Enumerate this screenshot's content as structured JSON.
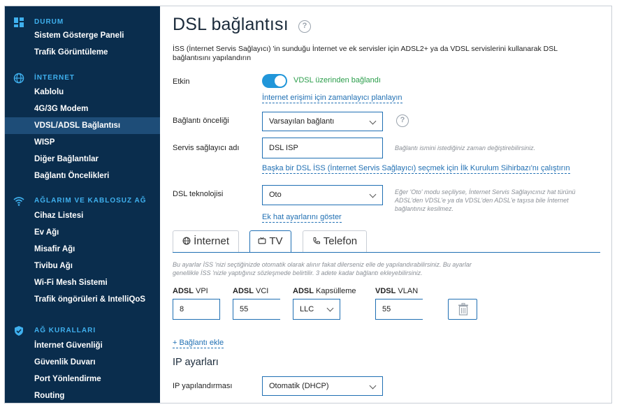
{
  "sidebar": {
    "sections": [
      {
        "title": "DURUM",
        "icon": "dashboard-icon",
        "items": [
          "Sistem Gösterge Paneli",
          "Trafik Görüntüleme"
        ]
      },
      {
        "title": "İNTERNET",
        "icon": "globe-icon",
        "items": [
          "Kablolu",
          "4G/3G Modem",
          "VDSL/ADSL Bağlantısı",
          "WISP",
          "Diğer Bağlantılar",
          "Bağlantı Öncelikleri"
        ]
      },
      {
        "title": "AĞLARIM VE KABLOSUZ AĞ",
        "icon": "wifi-icon",
        "items": [
          "Cihaz Listesi",
          "Ev Ağı",
          "Misafir Ağı",
          "Tivibu Ağı",
          "Wi-Fi Mesh Sistemi",
          "Trafik öngörüleri & IntelliQoS"
        ]
      },
      {
        "title": "AĞ KURALLARI",
        "icon": "shield-icon",
        "items": [
          "İnternet Güvenliği",
          "Güvenlik Duvarı",
          "Port Yönlendirme",
          "Routing"
        ]
      }
    ],
    "active_item": "VDSL/ADSL Bağlantısı",
    "colors": {
      "background": "#0a2d4d",
      "section_title": "#3fb0ee",
      "active_bg": "#1e4d78"
    }
  },
  "main": {
    "title": "DSL bağlantısı",
    "help_glyph": "?",
    "description": "İSS (İnternet Servis Sağlayıcı) 'in sunduğu İnternet ve ek servisler için ADSL2+ ya da VDSL servislerini kullanarak DSL bağlantısını yapılandırın",
    "enabled": {
      "label": "Etkin",
      "toggle_on": true,
      "status_text": "VDSL üzerinden bağlandı",
      "schedule_link": "İnternet erişimi için zamanlayıcı planlayın"
    },
    "priority": {
      "label": "Bağlantı önceliği",
      "value": "Varsayılan bağlantı"
    },
    "provider": {
      "label": "Servis sağlayıcı adı",
      "value": "DSL ISP",
      "hint": "Bağlantı ismini istediğiniz zaman değiştirebilirsiniz.",
      "wizard_link": "Başka bir DSL İSS (İnternet Servis Sağlayıcı) seçmek için İlk Kurulum Sihirbazı'nı çalıştırın"
    },
    "technology": {
      "label": "DSL teknolojisi",
      "value": "Oto",
      "hint": "Eğer 'Oto' modu seçiliyse, İnternet Servis Sağlayıcınız hat türünü ADSL'den VDSL'e ya da VDSL'den ADSL'e taşısa bile İnternet bağlantınız kesilmez.",
      "advanced_link": "Ek hat ayarlarını göster"
    },
    "tabs": [
      {
        "label": "İnternet",
        "icon": "globe-icon",
        "active": false
      },
      {
        "label": "TV",
        "icon": "tv-icon",
        "active": true
      },
      {
        "label": "Telefon",
        "icon": "phone-icon",
        "active": false
      }
    ],
    "tv": {
      "note": "Bu ayarlar İSS 'nizi seçtiğinizde otomatik olarak alınır fakat dilerseniz elle de yapılandırabilirsiniz. Bu ayarlar genellikle İSS 'nizle yaptığınız sözleşmede belirtilir. 3 adete kadar bağlantı ekleyebilirsiniz.",
      "columns": [
        {
          "bold": "ADSL",
          "rest": " VPI"
        },
        {
          "bold": "ADSL",
          "rest": " VCI"
        },
        {
          "bold": "ADSL",
          "rest": " Kapsülleme"
        },
        {
          "bold": "VDSL",
          "rest": " VLAN"
        }
      ],
      "row": {
        "vpi": "8",
        "vci": "55",
        "encapsulation": "LLC",
        "vlan": "55"
      },
      "add_link": "+ Bağlantı ekle"
    },
    "ip": {
      "heading": "IP ayarları",
      "label": "IP yapılandırması",
      "value": "Otomatik (DHCP)"
    },
    "colors": {
      "accent": "#1f6fb3",
      "toggle": "#2196d9",
      "status_green": "#2a9d4a"
    }
  }
}
